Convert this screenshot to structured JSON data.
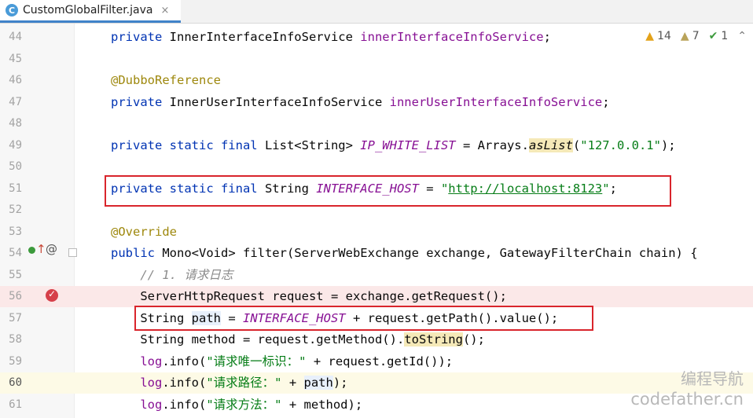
{
  "tab": {
    "icon_letter": "C",
    "title": "CustomGlobalFilter.java",
    "close": "×"
  },
  "inspections": {
    "warnings": "14",
    "weak_warnings": "7",
    "ok": "1"
  },
  "lines": [
    {
      "num": "44",
      "html": "<span class=\"kw\">private</span> InnerInterfaceInfoService <span class=\"fld\">innerInterfaceInfoService</span>;"
    },
    {
      "num": "45",
      "html": ""
    },
    {
      "num": "46",
      "html": "<span class=\"ann\">@DubboReference</span>"
    },
    {
      "num": "47",
      "html": "<span class=\"kw\">private</span> InnerUserInterfaceInfoService <span class=\"fld\">innerUserInterfaceInfoService</span>;"
    },
    {
      "num": "48",
      "html": ""
    },
    {
      "num": "49",
      "html": "<span class=\"kw\">private static final</span> List&lt;String&gt; <span class=\"const\">IP_WHITE_LIST</span> = Arrays.<span class=\"stat hl\">asList</span>(<span class=\"str\">\"127.0.0.1\"</span>);"
    },
    {
      "num": "50",
      "html": ""
    },
    {
      "num": "51",
      "html": "<span class=\"kw\">private static final</span> String <span class=\"const\">INTERFACE_HOST</span> = <span class=\"str\">\"</span><span class=\"link\">http://localhost:8123</span><span class=\"str\">\"</span>;"
    },
    {
      "num": "52",
      "html": ""
    },
    {
      "num": "53",
      "html": "<span class=\"ann\">@Override</span>"
    },
    {
      "num": "54",
      "html": "<span class=\"kw\">public</span> Mono&lt;Void&gt; filter(ServerWebExchange exchange, GatewayFilterChain chain) {"
    },
    {
      "num": "55",
      "html": "    <span class=\"cmt\">// 1. 请求日志</span>"
    },
    {
      "num": "56",
      "html": "    ServerHttpRequest request = exchange.getRequest();"
    },
    {
      "num": "57",
      "html": "    String <span class=\"var\">path</span> = <span class=\"const\">INTERFACE_HOST</span> + request.getPath().value();"
    },
    {
      "num": "58",
      "html": "    String method = request.getMethod().<span class=\"hl\">toString</span>();"
    },
    {
      "num": "59",
      "html": "    <span class=\"fld\">log</span>.info(<span class=\"str\">\"请求唯一标识：\"</span> + request.getId());"
    },
    {
      "num": "60",
      "html": "    <span class=\"fld\">log</span>.info(<span class=\"str\">\"请求路径：\"</span> + <span class=\"var\">path</span>);"
    },
    {
      "num": "61",
      "html": "    <span class=\"fld\">log</span>.info(<span class=\"str\">\"请求方法：\"</span> + method);"
    }
  ],
  "watermark": {
    "line1": "编程导航",
    "line2": "codefather.cn"
  }
}
